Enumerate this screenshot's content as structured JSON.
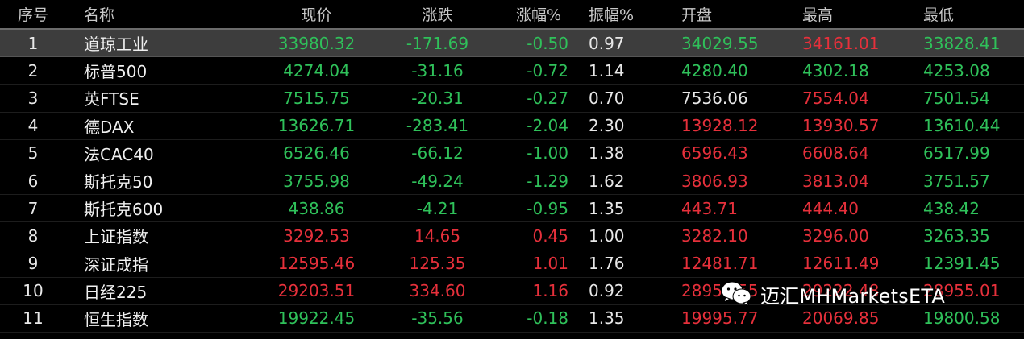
{
  "colors": {
    "up": "#e6303b",
    "down": "#2fc15a",
    "neutral": "#e8e8e8",
    "selected_row_bg": "#3d3d3d"
  },
  "headers": {
    "index": "序号",
    "name": "名称",
    "price": "现价",
    "change": "涨跌",
    "change_pct": "涨幅%",
    "amplitude": "振幅%",
    "open": "开盘",
    "high": "最高",
    "low": "最低"
  },
  "rows": [
    {
      "index": "1",
      "name": "道琼工业",
      "price": "33980.32",
      "change": "-171.69",
      "change_pct": "-0.50",
      "amplitude": "0.97",
      "open": "34029.55",
      "high": "34161.01",
      "low": "33828.41",
      "price_dir": "down",
      "change_dir": "down",
      "pct_dir": "down",
      "open_dir": "down",
      "high_dir": "up",
      "low_dir": "down"
    },
    {
      "index": "2",
      "name": "标普500",
      "price": "4274.04",
      "change": "-31.16",
      "change_pct": "-0.72",
      "amplitude": "1.14",
      "open": "4280.40",
      "high": "4302.18",
      "low": "4253.08",
      "price_dir": "down",
      "change_dir": "down",
      "pct_dir": "down",
      "open_dir": "down",
      "high_dir": "down",
      "low_dir": "down"
    },
    {
      "index": "3",
      "name": "英FTSE",
      "price": "7515.75",
      "change": "-20.31",
      "change_pct": "-0.27",
      "amplitude": "0.70",
      "open": "7536.06",
      "high": "7554.04",
      "low": "7501.54",
      "price_dir": "down",
      "change_dir": "down",
      "pct_dir": "down",
      "open_dir": "flat",
      "high_dir": "up",
      "low_dir": "down"
    },
    {
      "index": "4",
      "name": "德DAX",
      "price": "13626.71",
      "change": "-283.41",
      "change_pct": "-2.04",
      "amplitude": "2.30",
      "open": "13928.12",
      "high": "13930.57",
      "low": "13610.44",
      "price_dir": "down",
      "change_dir": "down",
      "pct_dir": "down",
      "open_dir": "up",
      "high_dir": "up",
      "low_dir": "down"
    },
    {
      "index": "5",
      "name": "法CAC40",
      "price": "6526.46",
      "change": "-66.12",
      "change_pct": "-1.00",
      "amplitude": "1.38",
      "open": "6596.43",
      "high": "6608.64",
      "low": "6517.99",
      "price_dir": "down",
      "change_dir": "down",
      "pct_dir": "down",
      "open_dir": "up",
      "high_dir": "up",
      "low_dir": "down"
    },
    {
      "index": "6",
      "name": "斯托克50",
      "price": "3755.98",
      "change": "-49.24",
      "change_pct": "-1.29",
      "amplitude": "1.62",
      "open": "3806.93",
      "high": "3813.04",
      "low": "3751.57",
      "price_dir": "down",
      "change_dir": "down",
      "pct_dir": "down",
      "open_dir": "up",
      "high_dir": "up",
      "low_dir": "down"
    },
    {
      "index": "7",
      "name": "斯托克600",
      "price": "438.86",
      "change": "-4.21",
      "change_pct": "-0.95",
      "amplitude": "1.35",
      "open": "443.71",
      "high": "444.40",
      "low": "438.42",
      "price_dir": "down",
      "change_dir": "down",
      "pct_dir": "down",
      "open_dir": "up",
      "high_dir": "up",
      "low_dir": "down"
    },
    {
      "index": "8",
      "name": "上证指数",
      "price": "3292.53",
      "change": "14.65",
      "change_pct": "0.45",
      "amplitude": "1.00",
      "open": "3282.10",
      "high": "3296.00",
      "low": "3263.35",
      "price_dir": "up",
      "change_dir": "up",
      "pct_dir": "up",
      "open_dir": "up",
      "high_dir": "up",
      "low_dir": "down"
    },
    {
      "index": "9",
      "name": "深证成指",
      "price": "12595.46",
      "change": "125.35",
      "change_pct": "1.01",
      "amplitude": "1.76",
      "open": "12481.71",
      "high": "12611.49",
      "low": "12391.45",
      "price_dir": "up",
      "change_dir": "up",
      "pct_dir": "up",
      "open_dir": "up",
      "high_dir": "up",
      "low_dir": "down"
    },
    {
      "index": "10",
      "name": "日经225",
      "price": "29203.51",
      "change": "334.60",
      "change_pct": "1.16",
      "amplitude": "0.92",
      "open": "28955.55",
      "high": "29222.48",
      "low": "28955.01",
      "price_dir": "up",
      "change_dir": "up",
      "pct_dir": "up",
      "open_dir": "up",
      "high_dir": "up",
      "low_dir": "up"
    },
    {
      "index": "11",
      "name": "恒生指数",
      "price": "19922.45",
      "change": "-35.56",
      "change_pct": "-0.18",
      "amplitude": "1.35",
      "open": "19995.77",
      "high": "20069.85",
      "low": "19800.58",
      "price_dir": "down",
      "change_dir": "down",
      "pct_dir": "down",
      "open_dir": "up",
      "high_dir": "up",
      "low_dir": "down"
    }
  ],
  "selected_row": 0,
  "watermark": {
    "icon": "wechat-icon",
    "text": "迈汇MHMarketsETA"
  }
}
